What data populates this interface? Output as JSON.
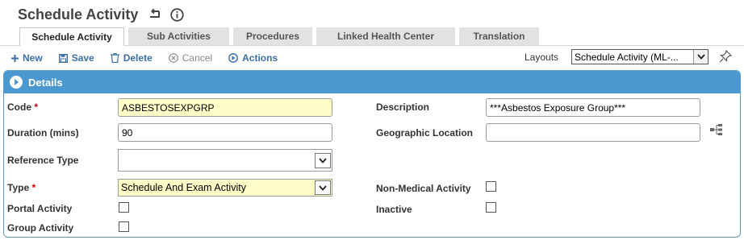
{
  "page": {
    "title": "Schedule Activity"
  },
  "tabs": [
    {
      "label": "Schedule Activity",
      "active": true
    },
    {
      "label": "Sub Activities",
      "active": false
    },
    {
      "label": "Procedures",
      "active": false
    },
    {
      "label": "Linked Health Center",
      "active": false
    },
    {
      "label": "Translation",
      "active": false
    }
  ],
  "toolbar": {
    "new_label": "New",
    "save_label": "Save",
    "delete_label": "Delete",
    "cancel_label": "Cancel",
    "actions_label": "Actions"
  },
  "layouts": {
    "label": "Layouts",
    "selected": "Schedule Activity (ML-..."
  },
  "panel": {
    "title": "Details"
  },
  "form": {
    "code": {
      "label": "Code",
      "value": "ASBESTOSEXPGRP",
      "required": true
    },
    "duration": {
      "label": "Duration (mins)",
      "value": "90"
    },
    "reference_type": {
      "label": "Reference Type",
      "value": ""
    },
    "type": {
      "label": "Type",
      "value": "Schedule And Exam Activity",
      "required": true
    },
    "portal_activity": {
      "label": "Portal Activity",
      "checked": false
    },
    "group_activity": {
      "label": "Group Activity",
      "checked": false
    },
    "description": {
      "label": "Description",
      "value": "***Asbestos Exposure Group***"
    },
    "geographic_location": {
      "label": "Geographic Location",
      "value": ""
    },
    "non_medical_activity": {
      "label": "Non-Medical Activity",
      "checked": false
    },
    "inactive": {
      "label": "Inactive",
      "checked": false
    },
    "required_marker": "*"
  },
  "colors": {
    "header_blue": "#4a98cf",
    "required_field": "#fefdc8",
    "link_blue": "#3a6fa8"
  }
}
